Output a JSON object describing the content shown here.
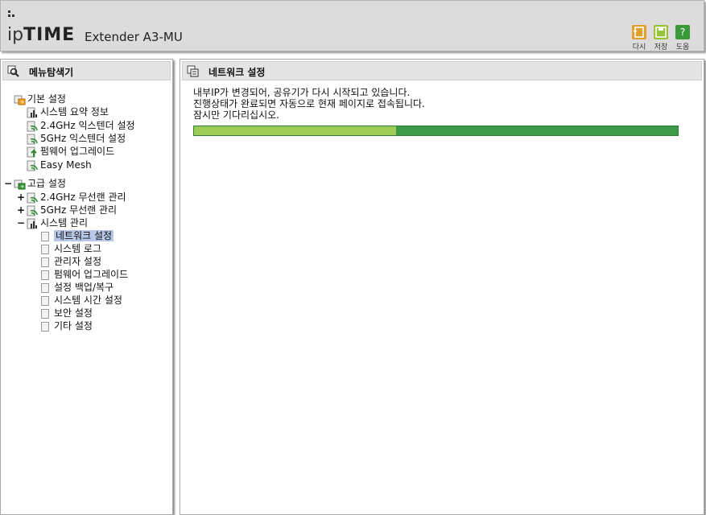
{
  "header": {
    "logo_ip": "ip",
    "logo_time": "TIME",
    "model": "Extender A3-MU",
    "buttons": [
      {
        "label": "다시",
        "icon": "refresh-icon",
        "color": "#e0a030"
      },
      {
        "label": "저장",
        "icon": "save-icon",
        "color": "#9ac23c"
      },
      {
        "label": "도움",
        "icon": "help-icon",
        "color": "#3a9a3a"
      }
    ]
  },
  "sidebar": {
    "title": "메뉴탐색기",
    "basic": {
      "label": "기본 설정",
      "items": [
        "시스템 요약 정보",
        "2.4GHz 익스텐더 설정",
        "5GHz 익스텐더 설정",
        "펌웨어 업그레이드",
        "Easy Mesh"
      ]
    },
    "advanced": {
      "toggle": "−",
      "label": "고급 설정",
      "groups": [
        {
          "toggle": "+",
          "label": "2.4GHz 무선랜 관리"
        },
        {
          "toggle": "+",
          "label": "5GHz 무선랜 관리"
        },
        {
          "toggle": "−",
          "label": "시스템 관리"
        }
      ],
      "system_items": [
        "네트워크 설정",
        "시스템 로그",
        "관리자 설정",
        "펌웨어 업그레이드",
        "설정 백업/복구",
        "시스템 시간 설정",
        "보안 설정",
        "기타 설정"
      ]
    }
  },
  "main": {
    "title": "네트워크 설정",
    "message_lines": [
      "내부IP가 변경되어, 공유기가 다시 시작되고 있습니다.",
      "진행상태가 완료되면 자동으로 현재 페이지로 접속됩니다.",
      "잠시만 기다리십시오."
    ],
    "progress_fraction": 0.417,
    "progress_colors": {
      "done": "#9dcb56",
      "remaining": "#3c9a46"
    }
  }
}
